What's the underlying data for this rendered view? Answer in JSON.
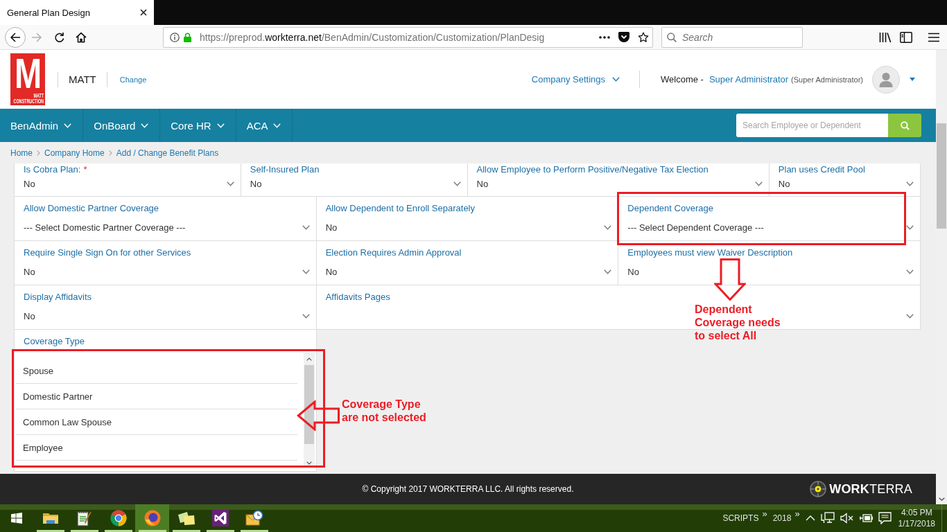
{
  "browser": {
    "tab": {
      "title": "General Plan Design"
    },
    "nav_buttons": [
      {
        "kind": "back",
        "disabled": false
      },
      {
        "kind": "forward",
        "disabled": true
      },
      {
        "kind": "reload",
        "disabled": false
      },
      {
        "kind": "home",
        "disabled": false
      }
    ],
    "address": {
      "prefix": "https://preprod.",
      "domain": "workterra.net",
      "path": "/BenAdmin/Customization/Customization/PlanDesig"
    },
    "search": {
      "placeholder": "Search"
    }
  },
  "header": {
    "logo": {
      "letter": "M",
      "caption": "MATT CONSTRUCTION"
    },
    "company": "MATT",
    "change_link": "Change",
    "settings_menu": "Company Settings",
    "welcome": "Welcome -",
    "user_name": "Super Administrator",
    "user_role": "(Super Administrator)"
  },
  "nav": {
    "items": [
      {
        "label": "BenAdmin"
      },
      {
        "label": "OnBoard"
      },
      {
        "label": "Core HR"
      },
      {
        "label": "ACA"
      }
    ],
    "search": {
      "placeholder": "Search Employee or Dependent"
    }
  },
  "breadcrumb": [
    "Home",
    "Company Home",
    "Add / Change Benefit Plans"
  ],
  "form": {
    "rows": [
      [
        {
          "kind": "select",
          "label": "Is Cobra Plan:",
          "required_mark": "*",
          "value": "No"
        },
        {
          "kind": "select",
          "label": "Self-Insured Plan",
          "value": "No"
        },
        {
          "kind": "select",
          "label": "Allow Employee to Perform Positive/Negative Tax Election",
          "value": "No"
        },
        {
          "kind": "select",
          "label": "Plan uses Credit Pool",
          "value": "No"
        }
      ],
      [
        {
          "kind": "select",
          "label": "Allow Domestic Partner Coverage",
          "value": "--- Select Domestic Partner Coverage ---"
        },
        {
          "kind": "select",
          "label": "Allow Dependent to Enroll Separately",
          "value": "No"
        },
        {
          "kind": "select",
          "label": "Dependent Coverage",
          "value": "--- Select Dependent Coverage ---"
        }
      ],
      [
        {
          "kind": "select",
          "label": "Require Single Sign On for other Services",
          "value": "No"
        },
        {
          "kind": "select",
          "label": "Election Requires Admin Approval",
          "value": "No"
        },
        {
          "kind": "select",
          "label": "Employees must view Waiver Description",
          "value": "No"
        }
      ],
      [
        {
          "kind": "select",
          "label": "Display Affidavits",
          "value": "No"
        },
        {
          "kind": "select",
          "label": "Affidavits Pages"
        }
      ],
      [
        {
          "kind": "listbox",
          "label": "Coverage Type",
          "options": [
            {
              "label": "Spouse",
              "selected": false
            },
            {
              "label": "Domestic Partner",
              "selected": false
            },
            {
              "label": "Common Law Spouse",
              "selected": false
            },
            {
              "label": "Employee",
              "selected": false
            }
          ]
        }
      ]
    ]
  },
  "annotations": [
    {
      "kind": "down",
      "note": "Dependent Coverage needs to select All"
    },
    {
      "kind": "left",
      "note": "Coverage Type are not selected"
    }
  ],
  "footer": {
    "copyright": "© Copyright 2017 WORKTERRA LLC. All rights reserved.",
    "brand": "**WORK**TERRA"
  },
  "taskbar": {
    "apps": [
      {
        "kind": "folder",
        "selected": false,
        "running": true
      },
      {
        "kind": "notepad",
        "selected": false,
        "running": true
      },
      {
        "kind": "ring",
        "selected": false,
        "running": true
      },
      {
        "kind": "fox",
        "selected": true,
        "running": true
      },
      {
        "kind": "notes",
        "selected": false,
        "running": true
      },
      {
        "kind": "ribbon",
        "selected": false,
        "running": true
      },
      {
        "kind": "mail",
        "selected": false,
        "running": true
      }
    ],
    "toolbars": [
      {
        "label": "SCRIPTS",
        "more": "»"
      },
      {
        "label": "2018",
        "more": "»"
      }
    ],
    "volume_muted": true,
    "time": "4:05 PM",
    "date": "1/17/2018"
  }
}
